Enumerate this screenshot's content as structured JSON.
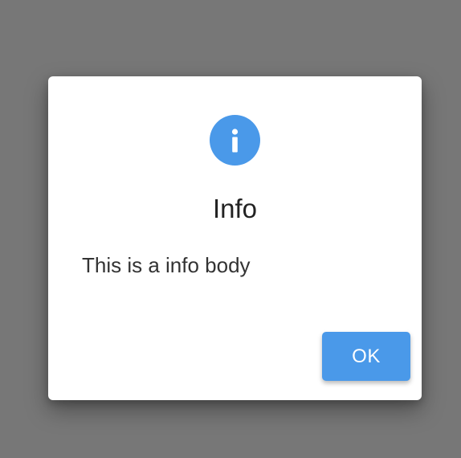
{
  "dialog": {
    "icon": "info-icon",
    "icon_glyph": "i",
    "title": "Info",
    "body": "This is a info body",
    "ok_label": "OK"
  },
  "colors": {
    "backdrop": "#777777",
    "dialog_background": "#ffffff",
    "accent": "#4a99e9",
    "title_text": "#222222",
    "body_text": "#333333",
    "button_text": "#ffffff"
  }
}
